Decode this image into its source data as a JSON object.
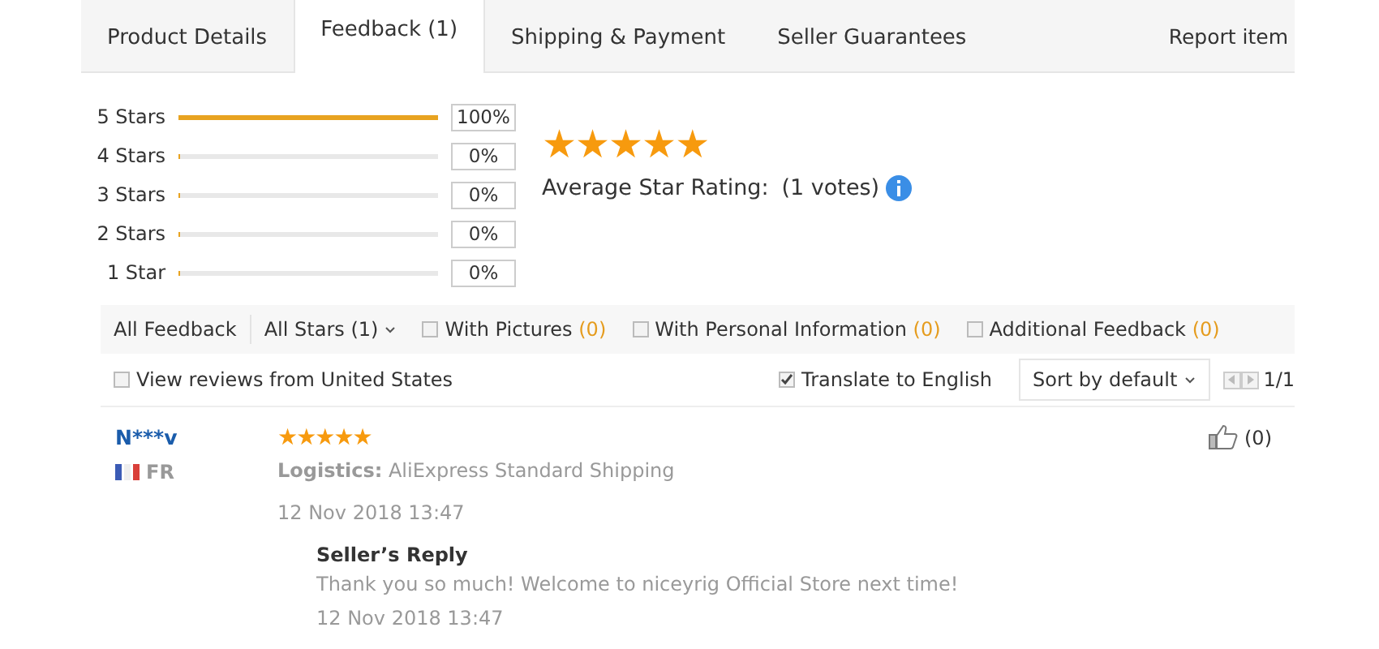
{
  "tabs": [
    {
      "label": "Product Details",
      "selected": false
    },
    {
      "label": "Feedback (1)",
      "selected": true
    },
    {
      "label": "Shipping & Payment",
      "selected": false
    },
    {
      "label": "Seller Guarantees",
      "selected": false
    }
  ],
  "report_link": "Report item",
  "rating_bars": [
    {
      "label": "5 Stars",
      "level": 1,
      "reading": "100%"
    },
    {
      "label": "4 Stars",
      "level": 0,
      "reading": "0%"
    },
    {
      "label": "3 Stars",
      "level": 0,
      "reading": "0%"
    },
    {
      "label": "2 Stars",
      "level": 0,
      "reading": "0%"
    },
    {
      "label": "1 Star",
      "level": 0,
      "reading": "0%"
    }
  ],
  "summary": {
    "stars": 5,
    "label": "Average Star Rating:",
    "votes": "(1 votes)"
  },
  "filters": [
    {
      "kind": "link",
      "label": "All Feedback"
    },
    {
      "kind": "dropdown",
      "label": "All Stars (1)"
    },
    {
      "kind": "checkbox",
      "label": "With Pictures",
      "count": "(0)",
      "checked": false
    },
    {
      "kind": "checkbox",
      "label": "With Personal Information",
      "count": "(0)",
      "checked": false
    },
    {
      "kind": "checkbox",
      "label": "Additional Feedback",
      "count": "(0)",
      "checked": false
    }
  ],
  "options": {
    "region": {
      "label": "View reviews from United States",
      "checked": false
    },
    "translate": {
      "label": "Translate to English",
      "checked": true
    },
    "sort": "Sort by default",
    "pager": "1/1"
  },
  "review": {
    "name": "N***v",
    "country": "FR",
    "stars": 5,
    "logistics_label": "Logistics:",
    "logistics": "AliExpress Standard Shipping",
    "date": "12 Nov 2018 13:47",
    "likes": "(0)",
    "reply": {
      "title": "Seller’s Reply",
      "text": "Thank you so much! Welcome to niceyrig Official Store next time!",
      "date": "12 Nov 2018 13:47"
    }
  }
}
